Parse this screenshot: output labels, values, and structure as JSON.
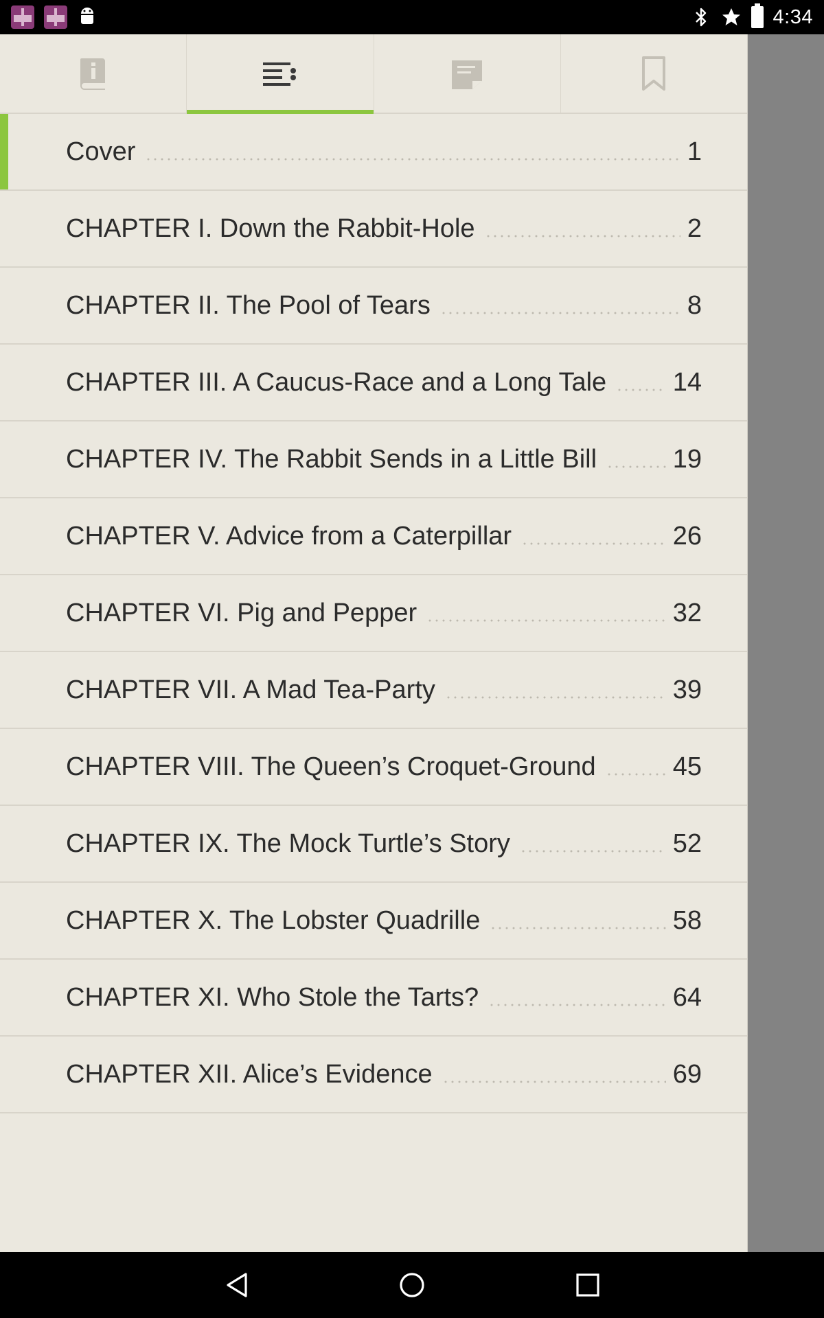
{
  "status_bar": {
    "time": "4:34",
    "left_icons": [
      "app-notification-icon",
      "app-notification-icon",
      "android-debug-icon"
    ],
    "right_icons": [
      "bluetooth-icon",
      "star-icon",
      "battery-icon"
    ]
  },
  "tabs": [
    {
      "name": "info",
      "icon": "book-info-icon",
      "active": false
    },
    {
      "name": "contents",
      "icon": "toc-list-icon",
      "active": true
    },
    {
      "name": "notes",
      "icon": "notes-icon",
      "active": false
    },
    {
      "name": "bookmarks",
      "icon": "bookmark-icon",
      "active": false
    }
  ],
  "toc": [
    {
      "title": "Cover",
      "page": "1"
    },
    {
      "title": "CHAPTER I. Down the Rabbit-Hole",
      "page": "2"
    },
    {
      "title": "CHAPTER II. The Pool of Tears",
      "page": "8"
    },
    {
      "title": "CHAPTER III. A Caucus-Race and a Long Tale",
      "page": "14"
    },
    {
      "title": "CHAPTER IV. The Rabbit Sends in a Little Bill",
      "page": "19"
    },
    {
      "title": "CHAPTER V. Advice from a Caterpillar",
      "page": "26"
    },
    {
      "title": "CHAPTER VI. Pig and Pepper",
      "page": "32"
    },
    {
      "title": "CHAPTER VII. A Mad Tea-Party",
      "page": "39"
    },
    {
      "title": "CHAPTER VIII. The Queen’s Croquet-Ground",
      "page": "45"
    },
    {
      "title": "CHAPTER IX. The Mock Turtle’s Story",
      "page": "52"
    },
    {
      "title": "CHAPTER X. The Lobster Quadrille",
      "page": "58"
    },
    {
      "title": "CHAPTER XI. Who Stole the Tarts?",
      "page": "64"
    },
    {
      "title": "CHAPTER XII. Alice’s Evidence",
      "page": "69"
    }
  ],
  "current_index": 0,
  "colors": {
    "accent": "#8cc63f",
    "panel": "#ebe8df",
    "overlay": "#838383"
  },
  "nav_bar": [
    "back-icon",
    "home-icon",
    "recents-icon"
  ]
}
